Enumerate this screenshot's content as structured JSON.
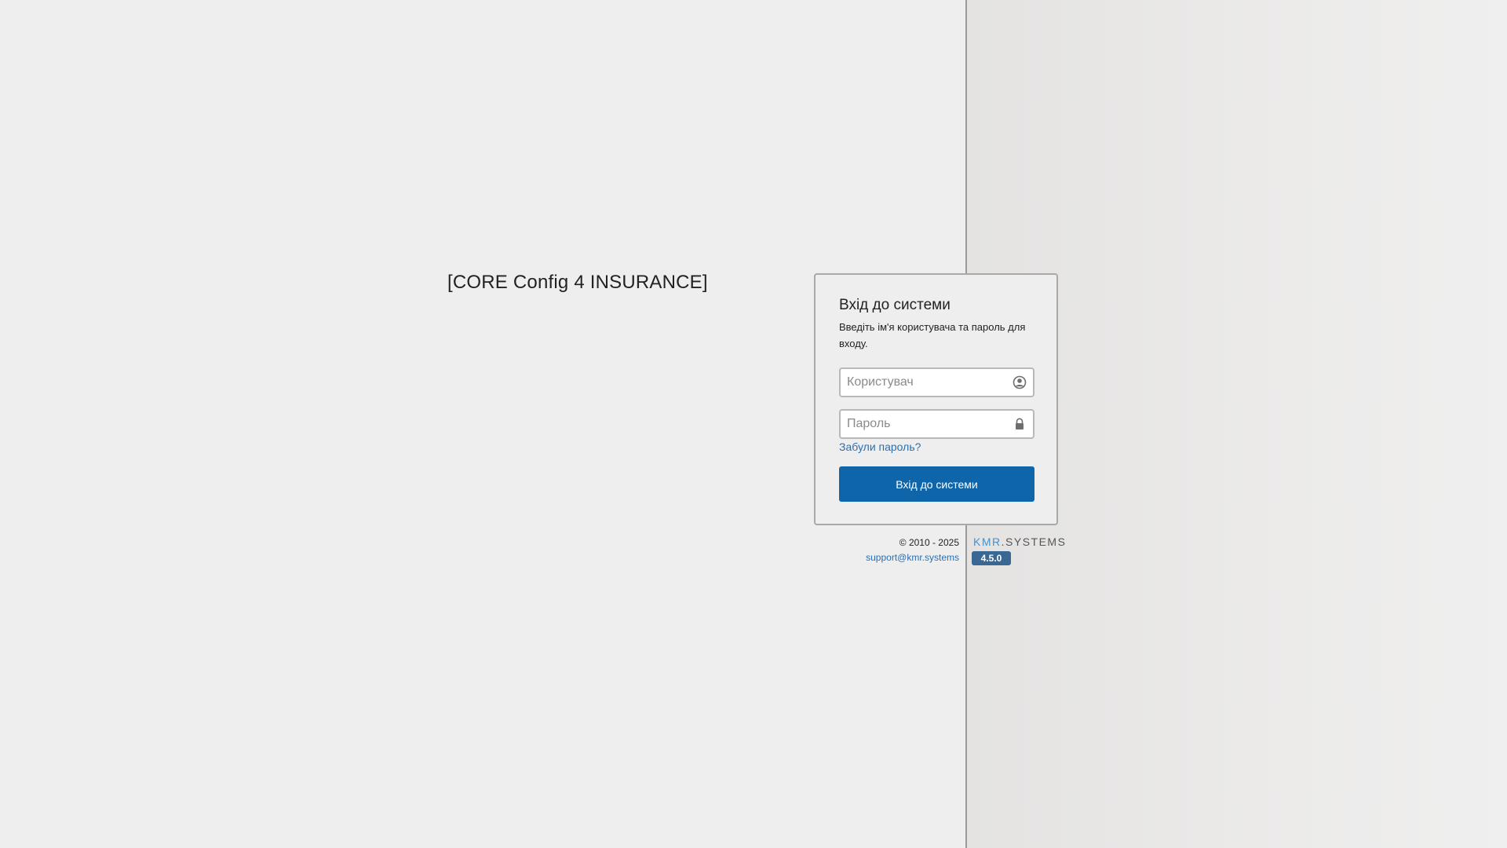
{
  "app": {
    "title": "[CORE Config 4 INSURANCE]"
  },
  "login": {
    "title": "Вхід до системи",
    "subtitle": "Введіть ім'я користувача та пароль для входу.",
    "username": {
      "value": "",
      "placeholder": "Користувач",
      "icon": "user-circle-icon"
    },
    "password": {
      "value": "",
      "placeholder": "Пароль",
      "icon": "lock-icon"
    },
    "forgot_link": "Забули пароль?",
    "submit_label": "Вхід до системи",
    "button_color": "#0f65a9"
  },
  "footer": {
    "copyright": "© 2010 - 2025",
    "support_email": "support@kmr.systems",
    "brand": "KMR.SYSTEMS",
    "version": "4.5.0"
  },
  "colors": {
    "link": "#2a6fb0",
    "version_badge": "#3a6894",
    "background": "#eeeeee"
  }
}
